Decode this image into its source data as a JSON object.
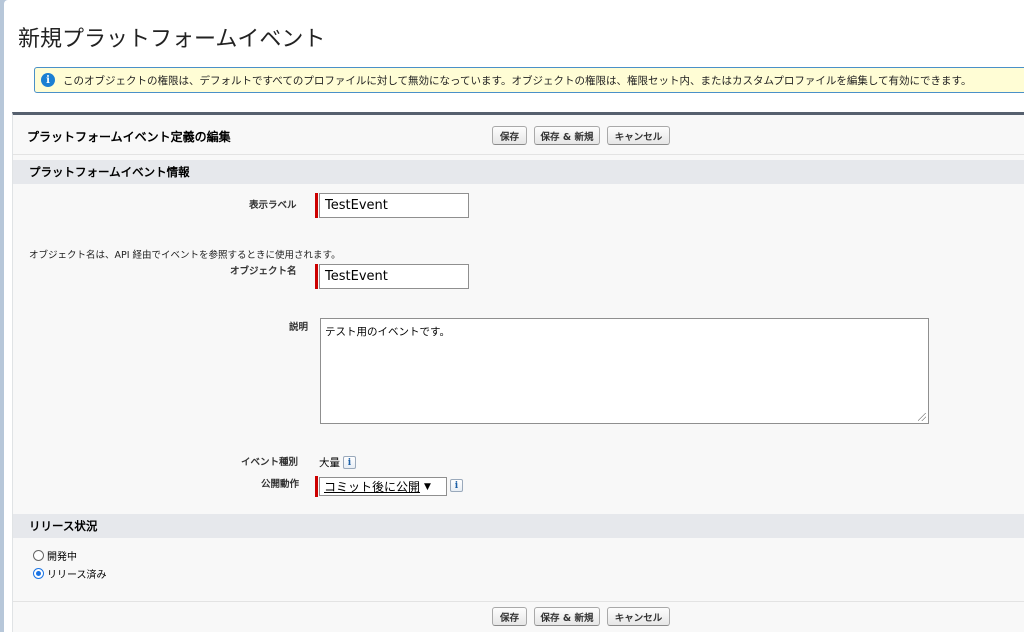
{
  "page": {
    "title": "新規プラットフォームイベント"
  },
  "banner": {
    "icon": "info-icon",
    "text": "このオブジェクトの権限は、デフォルトですべてのプロファイルに対して無効になっています。オブジェクトの権限は、権限セット内、またはカスタムプロファイルを編集して有効にできます。"
  },
  "form": {
    "title": "プラットフォームイベント定義の編集",
    "buttons": {
      "save": "保存",
      "save_new": "保存 & 新規",
      "cancel": "キャンセル"
    },
    "section_info": "プラットフォームイベント情報",
    "fields": {
      "label": {
        "label": "表示ラベル",
        "value": "TestEvent"
      },
      "object_help": "オブジェクト名は、API 経由でイベントを参照するときに使用されます。",
      "object_name": {
        "label": "オブジェクト名",
        "value": "TestEvent"
      },
      "description": {
        "label": "説明",
        "value": "テスト用のイベントです。"
      },
      "event_type": {
        "label": "イベント種別",
        "value": "大量"
      },
      "publish_behavior": {
        "label": "公開動作",
        "value": "コミット後に公開"
      }
    },
    "section_release": "リリース状況",
    "release_options": [
      {
        "label": "開発中",
        "checked": false
      },
      {
        "label": "リリース済み",
        "checked": true
      }
    ]
  },
  "colors": {
    "accent_blue": "#1b74e4",
    "required_red": "#cc0000",
    "banner_bg": "#fffdd5"
  }
}
